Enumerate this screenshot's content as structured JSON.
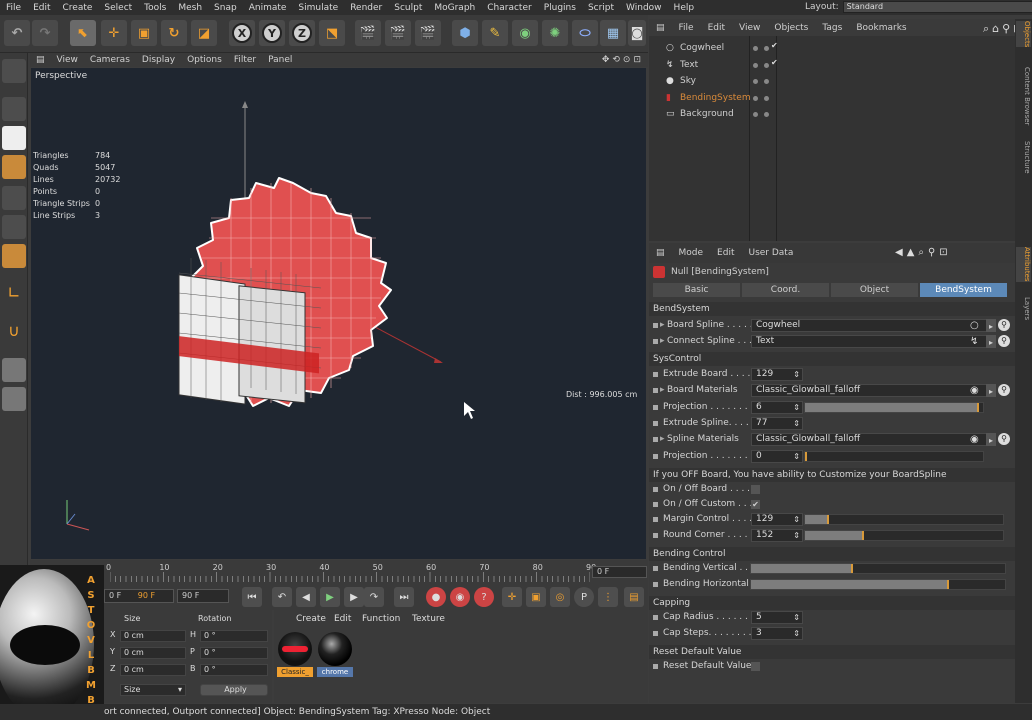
{
  "menu": [
    "File",
    "Edit",
    "Create",
    "Select",
    "Tools",
    "Mesh",
    "Snap",
    "Animate",
    "Simulate",
    "Render",
    "Sculpt",
    "MoGraph",
    "Character",
    "Plugins",
    "Script",
    "Window",
    "Help"
  ],
  "layout": {
    "label": "Layout:",
    "value": "Standard"
  },
  "viewport": {
    "menu": [
      "View",
      "Cameras",
      "Display",
      "Options",
      "Filter",
      "Panel"
    ],
    "label": "Perspective",
    "stats": [
      {
        "k": "Triangles",
        "v": "784"
      },
      {
        "k": "Quads",
        "v": "5047"
      },
      {
        "k": "Lines",
        "v": "20732"
      },
      {
        "k": "Points",
        "v": "0"
      },
      {
        "k": "Triangle Strips",
        "v": "0"
      },
      {
        "k": "Line Strips",
        "v": "3"
      }
    ],
    "dist": "Dist : 996.005 cm"
  },
  "timeline": {
    "ticks": [
      "0",
      "10",
      "20",
      "30",
      "40",
      "50",
      "60",
      "70",
      "80",
      "90"
    ],
    "frame": "0 F"
  },
  "transport": {
    "start": "0 F",
    "min": "90 F",
    "end": "90 F"
  },
  "coords": {
    "headers": [
      "Size",
      "Rotation"
    ],
    "rows": [
      {
        "axis": "X",
        "val": "0 cm",
        "rl": "H",
        "rv": "0 °"
      },
      {
        "axis": "Y",
        "val": "0 cm",
        "rl": "P",
        "rv": "0 °"
      },
      {
        "axis": "Z",
        "val": "0 cm",
        "rl": "B",
        "rv": "0 °"
      }
    ],
    "mode": "Size",
    "apply": "Apply"
  },
  "materials": {
    "menu": [
      "Create",
      "Edit",
      "Function",
      "Texture"
    ],
    "items": [
      {
        "name": "Classic_",
        "color": "#d9a040"
      },
      {
        "name": "chrome",
        "color": "#5577aa"
      }
    ]
  },
  "status": "ort connected, Outport connected] Object: BendingSystem Tag: XPresso Node: Object",
  "objects": {
    "menu": [
      "File",
      "Edit",
      "View",
      "Objects",
      "Tags",
      "Bookmarks"
    ],
    "items": [
      {
        "name": "Cogwheel",
        "color": "#d0d0d0"
      },
      {
        "name": "Text",
        "color": "#d0d0d0"
      },
      {
        "name": "Sky",
        "color": "#d0d0d0"
      },
      {
        "name": "BendingSystem",
        "color": "#d98a3a"
      },
      {
        "name": "Background",
        "color": "#d0d0d0"
      }
    ]
  },
  "sidetabs": [
    "Objects",
    "Content Browser",
    "Structure",
    "Attributes",
    "Layers"
  ],
  "attributes": {
    "menu": [
      "Mode",
      "Edit",
      "User Data"
    ],
    "title": "Null [BendingSystem]",
    "tabs": [
      "Basic",
      "Coord.",
      "Object",
      "BendSystem"
    ],
    "sections": {
      "s1": "BendSystem",
      "s2": "SysControl",
      "s3": "If you OFF Board, You have ability to Customize your BoardSpline",
      "s4": "Bending Control",
      "s5": "Capping",
      "s6": "Reset Default Value"
    },
    "props": {
      "board_spline": {
        "label": "Board Spline . . . . .",
        "value": "Cogwheel"
      },
      "connect_spline": {
        "label": "Connect Spline . . .",
        "value": "Text"
      },
      "extrude_board": {
        "label": "Extrude Board . . . .",
        "value": "129"
      },
      "board_materials": {
        "label": "Board Materials",
        "value": "Classic_Glowball_falloff"
      },
      "projection1": {
        "label": "Projection . . . . . . .",
        "value": "6",
        "fill": 0.98
      },
      "extrude_spline": {
        "label": "Extrude Spline. . . .",
        "value": "77"
      },
      "spline_materials": {
        "label": "Spline Materials",
        "value": "Classic_Glowball_falloff"
      },
      "projection2": {
        "label": "Projection . . . . . . .",
        "value": "0",
        "fill": 0.0
      },
      "onoff_board": {
        "label": "On / Off Board . . . ."
      },
      "onoff_custom": {
        "label": "On / Off Custom . . ."
      },
      "margin_control": {
        "label": "Margin Control . . . .",
        "value": "129",
        "fill": 0.12
      },
      "round_corner": {
        "label": "Round Corner . . . .",
        "value": "152",
        "fill": 0.3
      },
      "bending_vertical": {
        "label": "Bending Vertical . . .",
        "fill": 0.4
      },
      "bending_horizontal": {
        "label": "Bending Horizontal",
        "fill": 0.78
      },
      "cap_radius": {
        "label": "Cap Radius . . . . . . .",
        "value": "5"
      },
      "cap_steps": {
        "label": "Cap Steps. . . . . . . .",
        "value": "3"
      },
      "reset_default": {
        "label": "Reset Default Value"
      }
    }
  },
  "overlay_letters": [
    "A",
    "S",
    "T",
    "O",
    "V",
    "L",
    "B",
    "M",
    "B"
  ]
}
